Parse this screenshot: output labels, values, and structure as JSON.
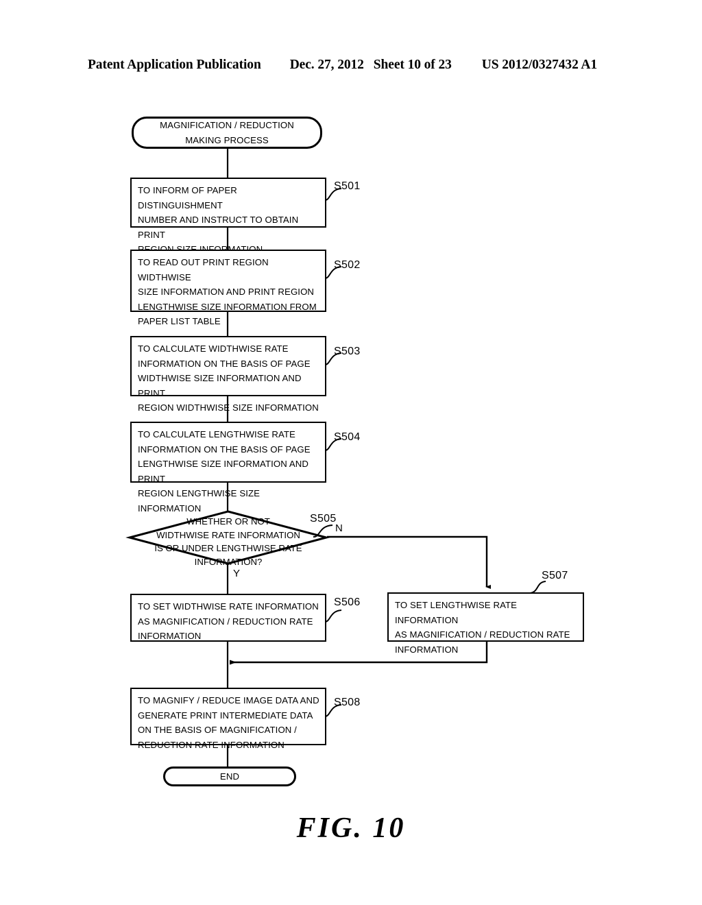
{
  "header": {
    "publication": "Patent Application Publication",
    "date": "Dec. 27, 2012",
    "sheet": "Sheet 10 of 23",
    "document_number": "US 2012/0327432 A1"
  },
  "figure": {
    "caption": "FIG. 10"
  },
  "flowchart": {
    "start": {
      "label": "MAGNIFICATION / REDUCTION\nMAKING PROCESS"
    },
    "steps": [
      {
        "ref": "S501",
        "text": "TO INFORM OF PAPER DISTINGUISHMENT\nNUMBER AND INSTRUCT TO OBTAIN PRINT\nREGION SIZE INFORMATION"
      },
      {
        "ref": "S502",
        "text": "TO READ OUT PRINT REGION WIDTHWISE\nSIZE INFORMATION AND PRINT REGION\nLENGTHWISE SIZE INFORMATION FROM\nPAPER LIST TABLE"
      },
      {
        "ref": "S503",
        "text": "TO CALCULATE WIDTHWISE RATE\nINFORMATION ON THE BASIS OF PAGE\nWIDTHWISE SIZE INFORMATION AND PRINT\nREGION WIDTHWISE SIZE INFORMATION"
      },
      {
        "ref": "S504",
        "text": "TO CALCULATE LENGTHWISE RATE\nINFORMATION ON THE BASIS OF PAGE\nLENGTHWISE SIZE INFORMATION AND PRINT\nREGION LENGTHWISE SIZE INFORMATION"
      }
    ],
    "decision": {
      "ref": "S505",
      "text": "WHETHER OR NOT\nWIDTHWISE RATE INFORMATION\nIS OR UNDER LENGTHWISE RATE\nINFORMATION?",
      "yes_label": "Y",
      "no_label": "N"
    },
    "yes_branch": {
      "ref": "S506",
      "text": "TO SET WIDTHWISE RATE INFORMATION\nAS MAGNIFICATION / REDUCTION RATE\nINFORMATION"
    },
    "no_branch": {
      "ref": "S507",
      "text": "TO SET LENGTHWISE RATE INFORMATION\nAS MAGNIFICATION / REDUCTION RATE\nINFORMATION"
    },
    "merge_step": {
      "ref": "S508",
      "text": "TO MAGNIFY / REDUCE IMAGE DATA AND\nGENERATE PRINT INTERMEDIATE DATA\nON THE BASIS OF MAGNIFICATION /\nREDUCTION RATE INFORMATION"
    },
    "end": {
      "label": "END"
    }
  },
  "colors": {
    "ink": "#000000",
    "paper": "#ffffff"
  }
}
